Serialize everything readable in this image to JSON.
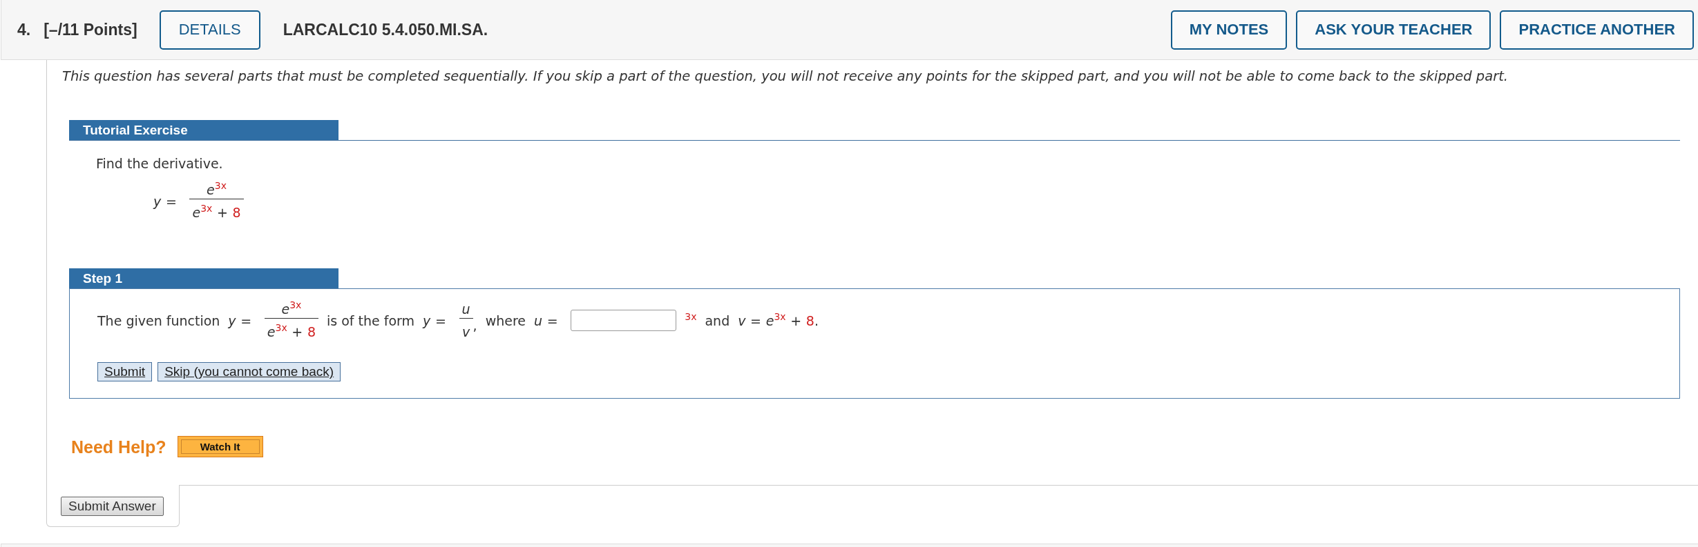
{
  "header": {
    "number": "4.",
    "points": "[–/11 Points]",
    "details_button": "DETAILS",
    "problem_code": "LARCALC10 5.4.050.MI.SA.",
    "actions": [
      "MY NOTES",
      "ASK YOUR TEACHER",
      "PRACTICE ANOTHER"
    ]
  },
  "instructions": "This question has several parts that must be completed sequentially. If you skip a part of the question, you will not receive any points for the skipped part, and you will not be able to come back to the skipped part.",
  "tutorial": {
    "title": "Tutorial Exercise",
    "prompt": "Find the derivative.",
    "formula": [
      {
        "kind": "math",
        "tokens": [
          {
            "kind": "var",
            "text": "y"
          },
          {
            "kind": "op",
            "text": "="
          }
        ]
      },
      {
        "kind": "fraction",
        "numerator": [
          {
            "kind": "var",
            "text": "e"
          },
          {
            "kind": "exp",
            "text": "3x"
          }
        ],
        "denominator": [
          {
            "kind": "var",
            "text": "e"
          },
          {
            "kind": "exp",
            "text": "3x"
          },
          {
            "kind": "op",
            "text": "+"
          },
          {
            "kind": "const",
            "text": "8"
          }
        ]
      }
    ]
  },
  "step": {
    "title": "Step 1",
    "statement": [
      {
        "kind": "text",
        "text": "The given function"
      },
      {
        "kind": "math",
        "tokens": [
          {
            "kind": "var",
            "text": "y"
          },
          {
            "kind": "op",
            "text": "="
          }
        ]
      },
      {
        "kind": "fraction",
        "numerator": [
          {
            "kind": "var",
            "text": "e"
          },
          {
            "kind": "exp",
            "text": "3x"
          }
        ],
        "denominator": [
          {
            "kind": "var",
            "text": "e"
          },
          {
            "kind": "exp",
            "text": "3x"
          },
          {
            "kind": "op",
            "text": "+"
          },
          {
            "kind": "const",
            "text": "8"
          }
        ]
      },
      {
        "kind": "text",
        "text": "is of the form"
      },
      {
        "kind": "math",
        "tokens": [
          {
            "kind": "var",
            "text": "y"
          },
          {
            "kind": "op",
            "text": "="
          }
        ]
      },
      {
        "kind": "fraction",
        "numerator": [
          {
            "kind": "var",
            "text": "u"
          }
        ],
        "denominator": [
          {
            "kind": "var",
            "text": "v"
          }
        ],
        "suffix": ","
      },
      {
        "kind": "text",
        "text": "where"
      },
      {
        "kind": "math",
        "tokens": [
          {
            "kind": "var",
            "text": "u"
          },
          {
            "kind": "op",
            "text": "="
          }
        ]
      },
      {
        "kind": "input"
      },
      {
        "kind": "math",
        "tokens": [
          {
            "kind": "exp",
            "text": "3x"
          }
        ]
      },
      {
        "kind": "text",
        "text": "and"
      },
      {
        "kind": "math",
        "tokens": [
          {
            "kind": "var",
            "text": "v"
          },
          {
            "kind": "op",
            "text": "="
          },
          {
            "kind": "var",
            "text": "e"
          },
          {
            "kind": "exp",
            "text": "3x"
          },
          {
            "kind": "op",
            "text": "+"
          },
          {
            "kind": "const",
            "text": "8"
          },
          {
            "kind": "punct",
            "text": "."
          }
        ]
      }
    ],
    "buttons": [
      "Submit",
      "Skip (you cannot come back)"
    ]
  },
  "help": {
    "label": "Need Help?",
    "buttons": [
      "Watch It"
    ]
  },
  "submit_button": "Submit Answer"
}
